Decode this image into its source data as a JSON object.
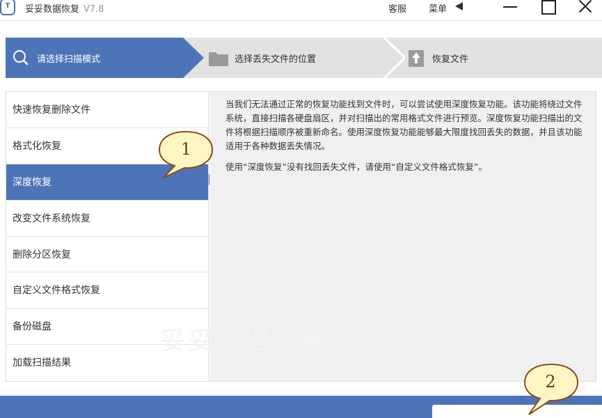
{
  "titlebar": {
    "logo_text": "T",
    "app_name": "妥妥数据恢复",
    "version": "V7.8",
    "service_label": "客服",
    "menu_label": "菜单"
  },
  "steps": [
    {
      "label": "请选择扫描模式",
      "icon": "search-icon",
      "active": true
    },
    {
      "label": "选择丢失文件的位置",
      "icon": "folder-icon",
      "active": false
    },
    {
      "label": "恢复文件",
      "icon": "upload-icon",
      "active": false
    }
  ],
  "sidebar": {
    "items": [
      {
        "label": "快速恢复删除文件"
      },
      {
        "label": "格式化恢复"
      },
      {
        "label": "深度恢复",
        "selected": true
      },
      {
        "label": "改变文件系统恢复"
      },
      {
        "label": "删除分区恢复"
      },
      {
        "label": "自定义文件格式恢复"
      },
      {
        "label": "备份磁盘"
      },
      {
        "label": "加载扫描结果"
      }
    ]
  },
  "description": {
    "paragraph1": "当我们无法通过正常的恢复功能找到文件时，可以尝试使用深度恢复功能。该功能将绕过文件系统，直接扫描各硬盘扇区，并对扫描出的常用格式文件进行预览。深度恢复功能扫描出的文件将根据扫描顺序被重新命名。使用深度恢复功能能够最大限度找回丢失的数据，并且该功能适用于各种数据丢失情况。",
    "paragraph2": "使用“深度恢复”没有找回丢失文件，请使用“自定义文件格式恢复”。"
  },
  "watermark": "妥妥数据恢复",
  "callouts": [
    {
      "number": "1"
    },
    {
      "number": "2"
    }
  ],
  "colors": {
    "accent": "#4e74b8",
    "step_inactive": "#e2e2e2",
    "callout_fill": "#fdf6c3",
    "callout_border": "#8b4a1c"
  }
}
